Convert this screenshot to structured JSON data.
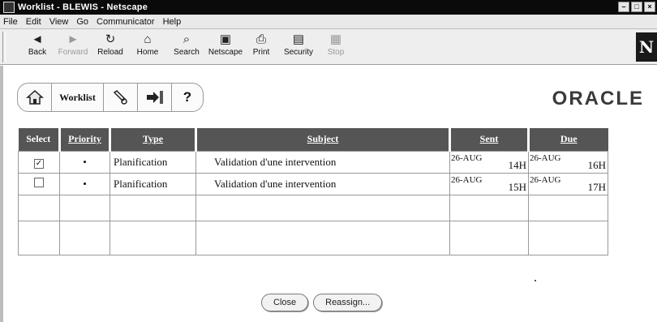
{
  "window": {
    "title": "Worklist - BLEWIS - Netscape",
    "controls": [
      "–",
      "□",
      "×"
    ]
  },
  "menu": [
    "File",
    "Edit",
    "View",
    "Go",
    "Communicator",
    "Help"
  ],
  "toolbar": {
    "buttons": [
      {
        "label": "Back",
        "icon": "back-arrow-icon",
        "enabled": true
      },
      {
        "label": "Forward",
        "icon": "forward-arrow-icon",
        "enabled": false
      },
      {
        "label": "Reload",
        "icon": "reload-icon",
        "enabled": true
      },
      {
        "label": "Home",
        "icon": "home-icon",
        "enabled": true
      },
      {
        "label": "Search",
        "icon": "search-icon",
        "enabled": true
      },
      {
        "label": "Netscape",
        "icon": "my-netscape-icon",
        "enabled": true
      },
      {
        "label": "Print",
        "icon": "printer-icon",
        "enabled": true
      },
      {
        "label": "Security",
        "icon": "padlock-icon",
        "enabled": true
      },
      {
        "label": "Stop",
        "icon": "stop-icon",
        "enabled": false
      }
    ],
    "logo": "N"
  },
  "app_nav": {
    "worklist_label": "Worklist",
    "help_label": "?"
  },
  "brand": {
    "logo_text": "ORACLE"
  },
  "table": {
    "headers": {
      "select": "Select",
      "priority": "Priority",
      "type": "Type",
      "subject": "Subject",
      "sent": "Sent",
      "due": "Due"
    },
    "rows": [
      {
        "selected": true,
        "priority": "•",
        "type": "Planification",
        "subject": "Validation d'une intervention",
        "sent_date": "26-AUG",
        "sent_hour": "14H",
        "due_date": "26-AUG",
        "due_hour": "16H"
      },
      {
        "selected": false,
        "priority": "•",
        "type": "Planification",
        "subject": "Validation d'une intervention",
        "sent_date": "26-AUG",
        "sent_hour": "15H",
        "due_date": "26-AUG",
        "due_hour": "17H"
      }
    ]
  },
  "actions": {
    "close_label": "Close",
    "reassign_label": "Reassign..."
  },
  "colors": {
    "header_bg": "#555555",
    "titlebar_bg": "#0a0a0a"
  }
}
